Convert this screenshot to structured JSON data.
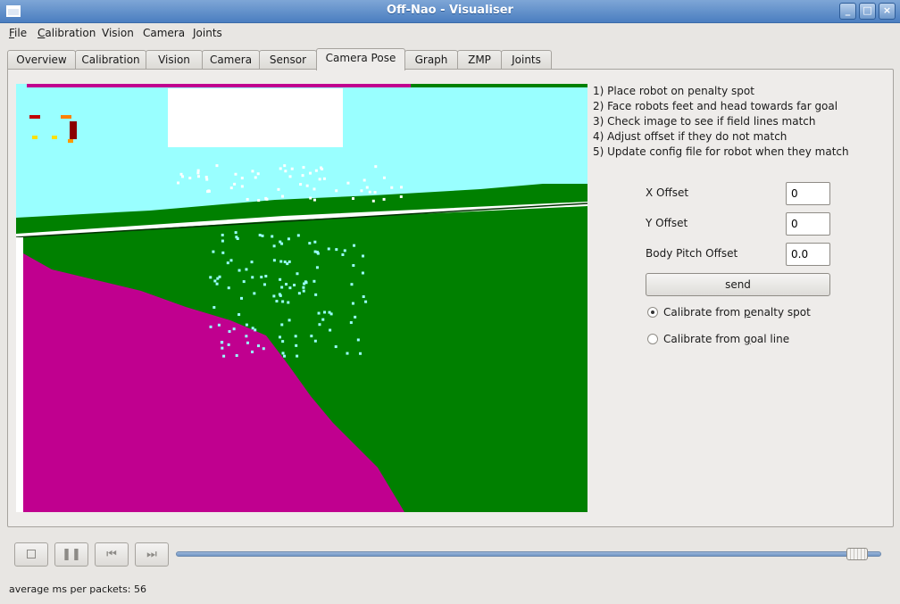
{
  "window": {
    "title": "Off-Nao - Visualiser"
  },
  "menubar": {
    "items": [
      {
        "label": "File",
        "mnemonic": "F",
        "rest": "ile"
      },
      {
        "label": "Calibration",
        "mnemonic": "C",
        "rest": "alibration"
      },
      {
        "label": "Vision",
        "mnemonic": "",
        "rest": "Vision"
      },
      {
        "label": "Camera",
        "mnemonic": "",
        "rest": "Camera"
      },
      {
        "label": "Joints",
        "mnemonic": "",
        "rest": "Joints"
      }
    ]
  },
  "tabs": [
    {
      "label": "Overview"
    },
    {
      "label": "Calibration"
    },
    {
      "label": "Vision"
    },
    {
      "label": "Camera"
    },
    {
      "label": "Sensor"
    },
    {
      "label": "Camera Pose",
      "active": true
    },
    {
      "label": "Graph"
    },
    {
      "label": "ZMP"
    },
    {
      "label": "Joints"
    }
  ],
  "camera_pose": {
    "instructions": [
      "1) Place robot on penalty spot",
      "2) Face robots feet and head towards far goal",
      "3) Check image to see if field lines match",
      "4) Adjust offset if they do not match",
      "5) Update config file for robot when they match"
    ],
    "x_offset_label": "X Offset",
    "x_offset_value": "0",
    "y_offset_label": "Y Offset",
    "y_offset_value": "0",
    "body_pitch_label": "Body Pitch Offset",
    "body_pitch_value": "0.0",
    "send_label": "send",
    "radio_penalty": {
      "before": "Calibrate from ",
      "mnemonic": "p",
      "after": "enalty spot",
      "checked": true
    },
    "radio_goal": {
      "before": "Calibrate from ",
      "mnemonic": "g",
      "after": "oal line",
      "checked": false
    }
  },
  "playback": {
    "stop_icon": "stop-icon",
    "pause_icon": "pause-icon",
    "rewind_icon": "skip-back-icon",
    "forward_icon": "skip-forward-icon",
    "position_fraction": 0.98
  },
  "status": {
    "text": "average ms per packets: 56"
  },
  "colors": {
    "field_green": "#008000",
    "sky_cyan": "#99ffff",
    "robot_magenta": "#c0008f",
    "titlebar_blue": "#5a8ac8"
  }
}
